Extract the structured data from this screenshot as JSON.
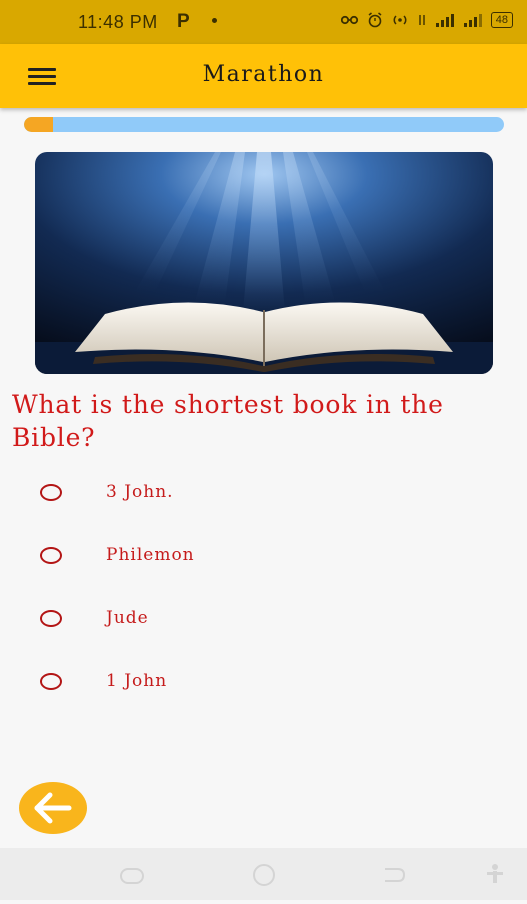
{
  "status_bar": {
    "time": "11:48 PM",
    "notification": "P",
    "battery": "48"
  },
  "app_bar": {
    "title": "Marathon",
    "menu_icon": "hamburger-menu-icon"
  },
  "progress": {
    "fraction": 0.06,
    "fill_color": "#f5a623",
    "track_color": "#90caf9"
  },
  "question": {
    "image": "open-bible-with-light-rays",
    "text": "What is the shortest book in the Bible?",
    "options": [
      {
        "label": "3 John."
      },
      {
        "label": "Philemon"
      },
      {
        "label": "Jude"
      },
      {
        "label": "1 John"
      }
    ]
  },
  "back_button": {
    "icon": "arrow-left-icon",
    "color": "#f9b51c"
  },
  "colors": {
    "accent": "#ffc107",
    "question_red": "#d11a1a"
  }
}
